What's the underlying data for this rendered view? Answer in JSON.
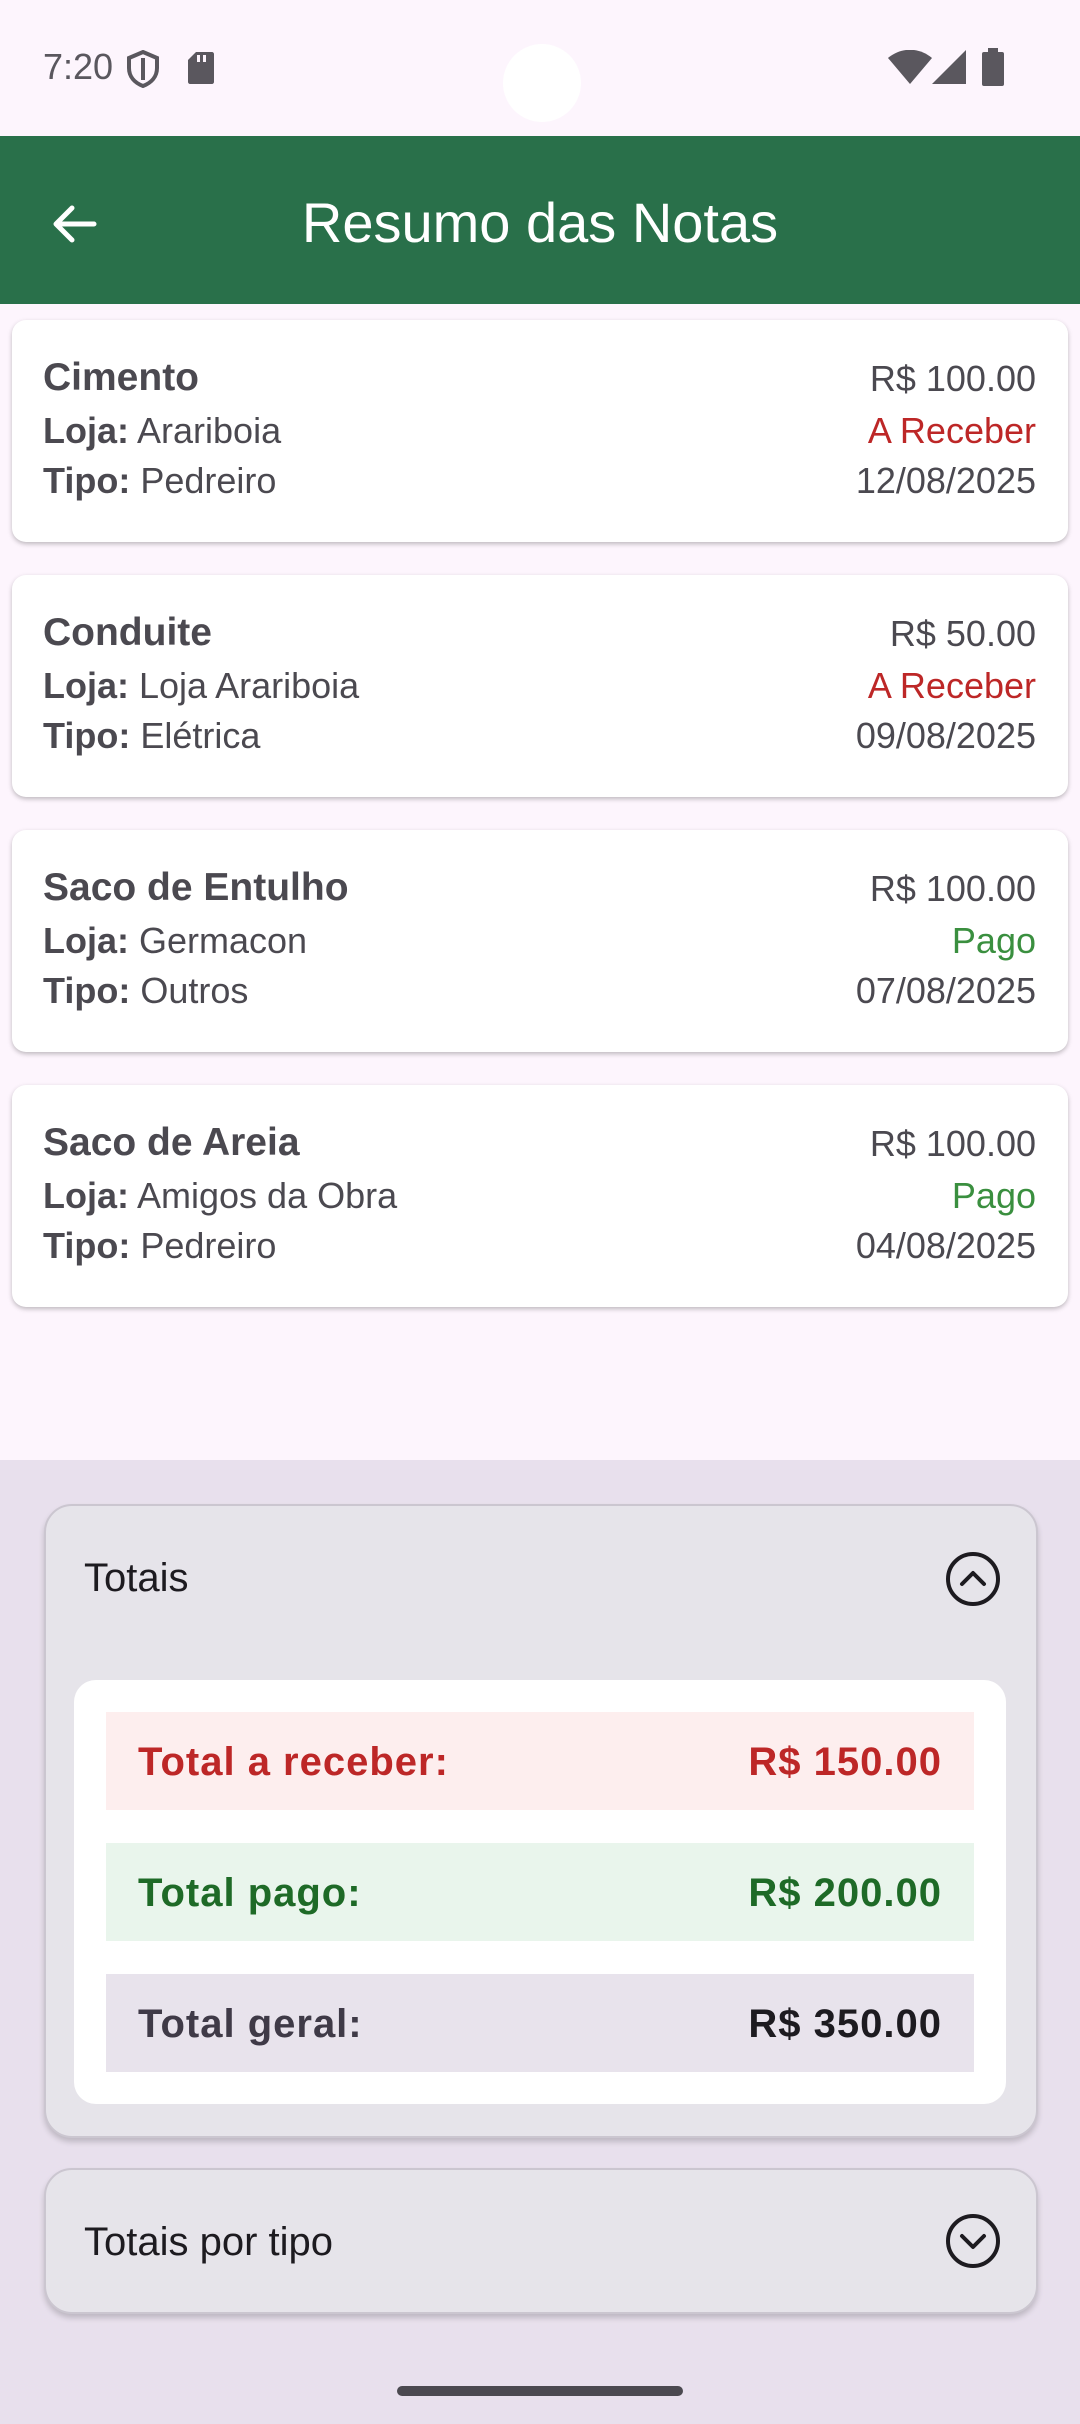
{
  "status_bar": {
    "time": "7:20"
  },
  "app_bar": {
    "title": "Resumo das Notas"
  },
  "notes": [
    {
      "name": "Cimento",
      "value": "R$ 100.00",
      "store_label": "Loja:",
      "store": "Arariboia",
      "type_label": "Tipo:",
      "type": "Pedreiro",
      "status": "A Receber",
      "date": "12/08/2025"
    },
    {
      "name": "Conduite",
      "value": "R$ 50.00",
      "store_label": "Loja:",
      "store": "Loja Arariboia",
      "type_label": "Tipo:",
      "type": "Elétrica",
      "status": "A Receber",
      "date": "09/08/2025"
    },
    {
      "name": "Saco de Entulho",
      "value": "R$ 100.00",
      "store_label": "Loja:",
      "store": "Germacon",
      "type_label": "Tipo:",
      "type": "Outros",
      "status": "Pago",
      "date": "07/08/2025"
    },
    {
      "name": "Saco de Areia",
      "value": "R$ 100.00",
      "store_label": "Loja:",
      "store": "Amigos da Obra",
      "type_label": "Tipo:",
      "type": "Pedreiro",
      "status": "Pago",
      "date": "04/08/2025"
    }
  ],
  "totals": {
    "title": "Totais",
    "receber_label": "Total a receber:",
    "receber_value": "R$ 150.00",
    "pago_label": "Total pago:",
    "pago_value": "R$ 200.00",
    "geral_label": "Total geral:",
    "geral_value": "R$ 350.00"
  },
  "totals_by_type": {
    "title": "Totais por tipo"
  },
  "colors": {
    "app_bar": "#29704a",
    "receber": "#bd2727",
    "pago": "#3a8f3f"
  },
  "icons": {
    "back": "arrow-back-icon",
    "collapse": "chevron-up-circle-icon",
    "expand": "chevron-down-circle-icon"
  }
}
